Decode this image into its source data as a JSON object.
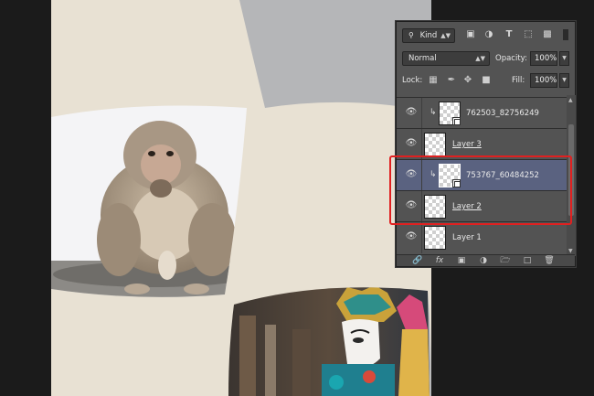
{
  "panel": {
    "filter": {
      "kind_label": "Kind"
    },
    "blend_mode": "Normal",
    "opacity_label": "Opacity:",
    "opacity_value": "100%",
    "lock_label": "Lock:",
    "fill_label": "Fill:",
    "fill_value": "100%",
    "layers": [
      {
        "name": "762503_82756249",
        "clipped": true,
        "smart_object": true,
        "selected": false
      },
      {
        "name": "Layer 3",
        "clipped": false,
        "smart_object": false,
        "selected": false
      },
      {
        "name": "753767_60484252",
        "clipped": true,
        "smart_object": true,
        "selected": true
      },
      {
        "name": "Layer 2",
        "clipped": false,
        "smart_object": false,
        "selected": false
      },
      {
        "name": "Layer 1",
        "clipped": false,
        "smart_object": false,
        "selected": false
      }
    ]
  },
  "colors": {
    "canvas_cream": "#e8e1d3",
    "canvas_gray": "#b5b6b8",
    "workspace": "#1b1b1b",
    "selection_highlight": "#e02020"
  },
  "icons": {
    "filter": [
      "search-icon",
      "image-filter-icon",
      "adjustment-filter-icon",
      "type-filter-icon",
      "shape-filter-icon",
      "smart-filter-icon",
      "filter-toggle-icon"
    ],
    "lock": [
      "lock-transparent-icon",
      "lock-image-icon",
      "lock-position-icon",
      "lock-all-icon"
    ],
    "footer": [
      "link-layers-icon",
      "fx-icon",
      "mask-icon",
      "adjustment-icon",
      "folder-icon",
      "new-layer-icon",
      "trash-icon"
    ]
  }
}
